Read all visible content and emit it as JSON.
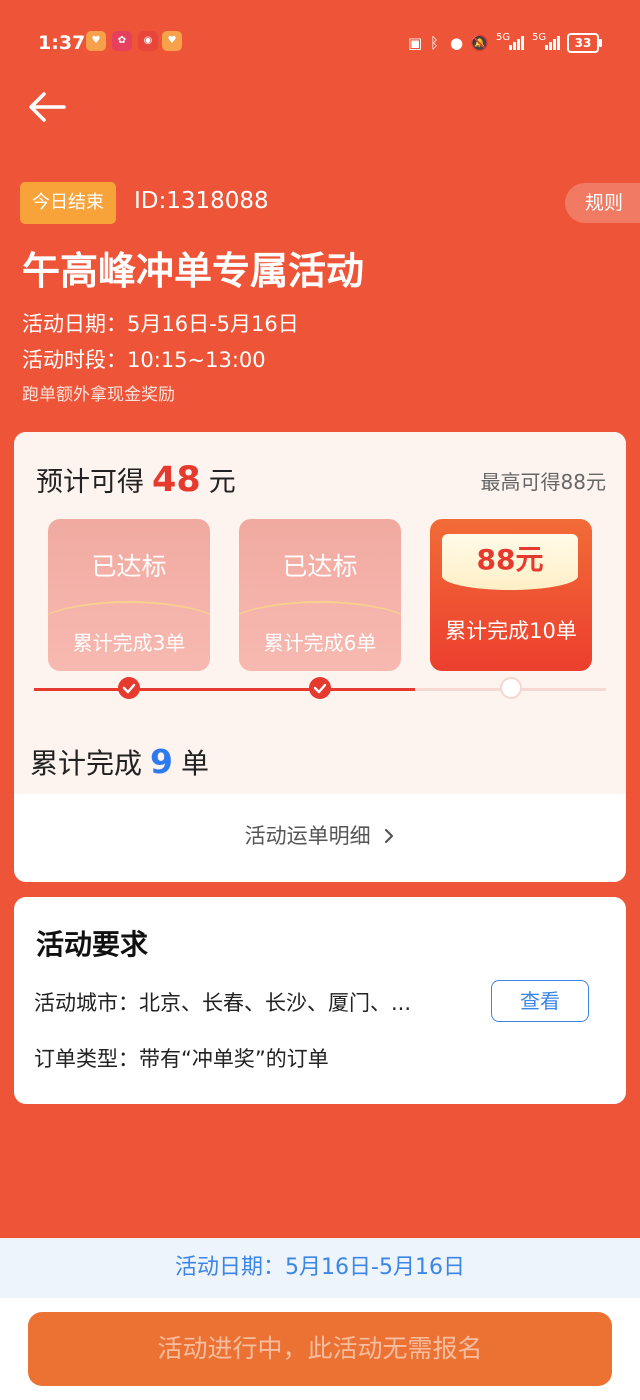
{
  "status_bar": {
    "time": "1:37",
    "signal_label": "5G",
    "battery": "33"
  },
  "header": {
    "badge": "今日结束",
    "activity_id": "ID:1318088",
    "rules_label": "规则",
    "title": "午高峰冲单专属活动",
    "date_line": "活动日期：5月16日-5月16日",
    "time_line": "活动时段：10:15~13:00",
    "subtitle": "跑单额外拿现金奖励"
  },
  "progress": {
    "estimate_prefix": "预计可得",
    "estimate_amount": "48",
    "estimate_unit": "元",
    "max_reward": "最高可得88元",
    "tiers": [
      {
        "state": "已达标",
        "requirement": "累计完成3单"
      },
      {
        "state": "已达标",
        "requirement": "累计完成6单"
      },
      {
        "reward": "88元",
        "requirement": "累计完成10单"
      }
    ],
    "completed_prefix": "累计完成",
    "completed_count": "9",
    "completed_unit": "单",
    "detail_link": "活动运单明细"
  },
  "requirements": {
    "title": "活动要求",
    "city_line": "活动城市：北京、长春、长沙、厦门、...",
    "view_button": "查看",
    "order_type_line": "订单类型：带有“冲单奖”的订单"
  },
  "footer": {
    "date_bar": "活动日期：5月16日-5月16日",
    "cta": "活动进行中，此活动无需报名"
  },
  "colors": {
    "primary_red": "#EE5538",
    "highlight_red": "#E63A2F",
    "link_blue": "#3C86E6",
    "cta_orange": "#EC7234"
  }
}
